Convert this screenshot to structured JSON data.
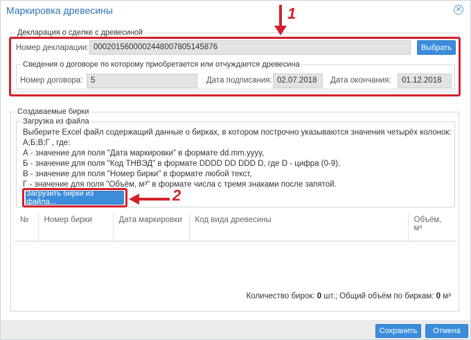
{
  "dialog": {
    "title": "Маркировка древесины"
  },
  "declaration": {
    "legend": "Декларация о сделке с древесиной",
    "number_label": "Номер декларации:",
    "number_value": "0002015600002448007805145876",
    "select_button": "Выбрать",
    "contract": {
      "legend": "Сведения о договоре по которому приобретается или отчуждается древесина",
      "contract_number_label": "Номер договора:",
      "contract_number_value": "5",
      "sign_date_label": "Дата подписания:",
      "sign_date_value": "02.07.2018",
      "end_date_label": "Дата окончания:",
      "end_date_value": "01.12.2018"
    }
  },
  "tags": {
    "legend": "Создаваемые бирки",
    "upload": {
      "legend": "Загрузка из файла",
      "instructions": [
        "Выберите Excel файл содержащий данные о бирках, в котором построчно указываются значения четырёх колонок:",
        "А;Б;В;Г , где:",
        "А - значение для поля \"Дата маркировки\" в формате dd.mm.yyyy,",
        "Б - значение для поля \"Код ТНВЭД\" в формате DDDD DD DDD D, где D - цифра (0-9),",
        "В - значение для поля \"Номер бирки\" в формате любой текст,",
        "Г - значение для поля \"Объём, м³\" в формате числа с тремя знаками после запятой."
      ],
      "upload_button": "Загрузить бирки из файла..."
    },
    "table": {
      "columns": [
        "№",
        "Номер бирки",
        "Дата маркировки",
        "Код вида древесины",
        "Объём, м³"
      ]
    },
    "summary": {
      "count_label": "Количество бирок:",
      "count_value": "0",
      "count_unit": "шт.;",
      "volume_label": "Общий объём по биркам:",
      "volume_value": "0",
      "volume_unit": "м³"
    }
  },
  "footer": {
    "save_button": "Сохранить",
    "cancel_button": "Отмена"
  },
  "annotations": {
    "callout_1": "1",
    "callout_2": "2",
    "color": "#d4202a"
  }
}
